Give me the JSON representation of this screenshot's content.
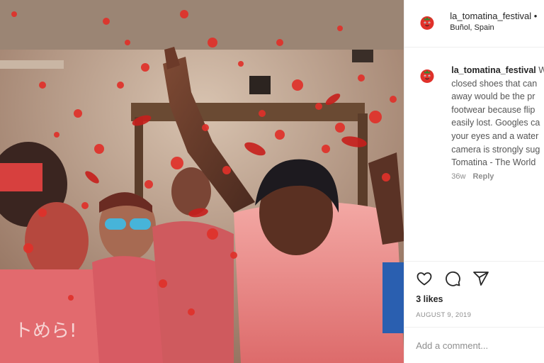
{
  "post": {
    "username": "la_tomatina_festival",
    "header_suffix": " •",
    "location": "Buñol, Spain",
    "caption_username": "la_tomatina_festival",
    "caption_lines": [
      " W",
      "closed shoes that can",
      "away would be the pr",
      "footwear because flip",
      "easily lost. Googles ca",
      "your eyes and a water",
      "camera is strongly sug",
      "Tomatina - The World"
    ],
    "caption_age": "36w",
    "reply_label": "Reply",
    "likes": "3 likes",
    "date": "AUGUST 9, 2019",
    "comment_placeholder": "Add a comment..."
  },
  "icons": {
    "avatar": "tomato-avatar-icon",
    "like": "heart-icon",
    "comment": "comment-bubble-icon",
    "share": "paper-plane-icon"
  },
  "colors": {
    "tomato_red": "#e0312a",
    "text_primary": "#262626",
    "text_secondary": "#8e8e8e",
    "divider": "#efefef"
  },
  "photo": {
    "shirt_text": "トめら!",
    "description_icon": "festival-photo"
  }
}
